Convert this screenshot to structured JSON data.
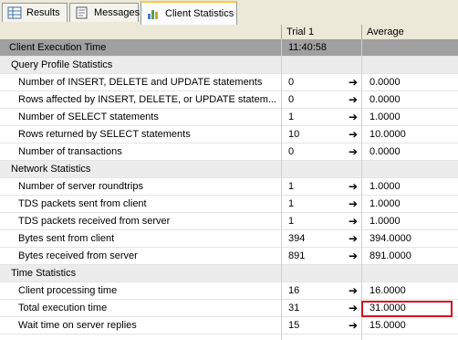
{
  "tabs": [
    {
      "label": "Results",
      "icon": "grid-icon"
    },
    {
      "label": "Messages",
      "icon": "document-icon"
    },
    {
      "label": "Client Statistics",
      "icon": "statistics-icon"
    }
  ],
  "header": {
    "col1": "",
    "col2": "Trial 1",
    "col3": "Average"
  },
  "rows": [
    {
      "type": "title",
      "label": "Client Execution Time",
      "trial": "11:40:58",
      "avg": "",
      "arrow": ""
    },
    {
      "type": "section",
      "label": "Query Profile Statistics",
      "trial": "",
      "avg": "",
      "arrow": ""
    },
    {
      "type": "data",
      "label": "Number of INSERT, DELETE and UPDATE statements",
      "trial": "0",
      "avg": "0.0000",
      "arrow": "➔"
    },
    {
      "type": "data",
      "label": "Rows affected by INSERT, DELETE, or UPDATE statem...",
      "trial": "0",
      "avg": "0.0000",
      "arrow": "➔"
    },
    {
      "type": "data",
      "label": "Number of SELECT statements",
      "trial": "1",
      "avg": "1.0000",
      "arrow": "➔"
    },
    {
      "type": "data",
      "label": "Rows returned by SELECT statements",
      "trial": "10",
      "avg": "10.0000",
      "arrow": "➔"
    },
    {
      "type": "data",
      "label": "Number of transactions",
      "trial": "0",
      "avg": "0.0000",
      "arrow": "➔"
    },
    {
      "type": "section",
      "label": "Network Statistics",
      "trial": "",
      "avg": "",
      "arrow": ""
    },
    {
      "type": "data",
      "label": "Number of server roundtrips",
      "trial": "1",
      "avg": "1.0000",
      "arrow": "➔"
    },
    {
      "type": "data",
      "label": "TDS packets sent from client",
      "trial": "1",
      "avg": "1.0000",
      "arrow": "➔"
    },
    {
      "type": "data",
      "label": "TDS packets received from server",
      "trial": "1",
      "avg": "1.0000",
      "arrow": "➔"
    },
    {
      "type": "data",
      "label": "Bytes sent from client",
      "trial": "394",
      "avg": "394.0000",
      "arrow": "➔"
    },
    {
      "type": "data",
      "label": "Bytes received from server",
      "trial": "891",
      "avg": "891.0000",
      "arrow": "➔"
    },
    {
      "type": "section",
      "label": "Time Statistics",
      "trial": "",
      "avg": "",
      "arrow": ""
    },
    {
      "type": "data",
      "label": "Client processing time",
      "trial": "16",
      "avg": "16.0000",
      "arrow": "➔"
    },
    {
      "type": "data",
      "label": "Total execution time",
      "trial": "31",
      "avg": "31.0000",
      "arrow": "➔"
    },
    {
      "type": "data",
      "label": "Wait time on server replies",
      "trial": "15",
      "avg": "15.0000",
      "arrow": "➔"
    }
  ],
  "highlight_color": "#d0131f"
}
